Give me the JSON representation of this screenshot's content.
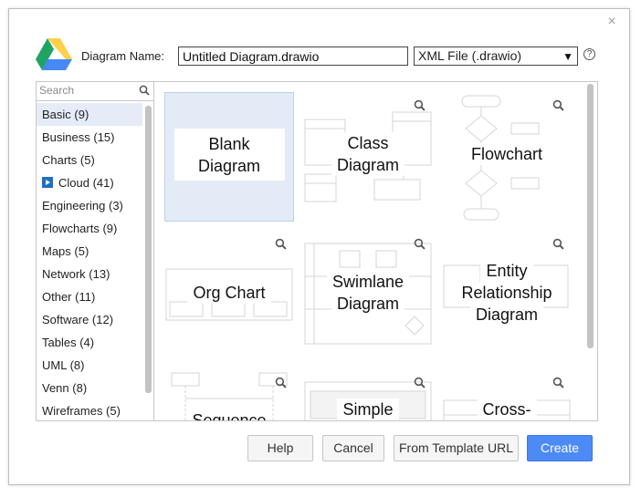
{
  "header": {
    "name_label": "Diagram Name:",
    "name_value": "Untitled Diagram.drawio",
    "format_value": "XML File (.drawio)",
    "help_glyph": "?",
    "close_glyph": "×"
  },
  "sidebar": {
    "search_placeholder": "Search",
    "categories": [
      {
        "label": "Basic (9)"
      },
      {
        "label": "Business (15)"
      },
      {
        "label": "Charts (5)"
      },
      {
        "label": "Cloud (41)"
      },
      {
        "label": "Engineering (3)"
      },
      {
        "label": "Flowcharts (9)"
      },
      {
        "label": "Maps (5)"
      },
      {
        "label": "Network (13)"
      },
      {
        "label": "Other (11)"
      },
      {
        "label": "Software (12)"
      },
      {
        "label": "Tables (4)"
      },
      {
        "label": "UML (8)"
      },
      {
        "label": "Venn (8)"
      },
      {
        "label": "Wireframes (5)"
      }
    ]
  },
  "templates": [
    {
      "l1": "Blank",
      "l2": "Diagram"
    },
    {
      "l1": "Class",
      "l2": "Diagram"
    },
    {
      "l1": "Flowchart"
    },
    {
      "l1": "Org Chart"
    },
    {
      "l1": "Swimlane",
      "l2": "Diagram"
    },
    {
      "l1": "Entity",
      "l2": "Relationship",
      "l3": "Diagram"
    },
    {
      "l1": "Sequence"
    },
    {
      "l1": "Simple"
    },
    {
      "l1": "Cross-"
    }
  ],
  "buttons": {
    "help": "Help",
    "cancel": "Cancel",
    "from_template_url": "From Template URL",
    "create": "Create"
  },
  "colors": {
    "primary": "#4c8bf5",
    "selection": "#e3ebf6",
    "drive_green": "#1fa463",
    "drive_yellow": "#ffd04b",
    "drive_blue": "#4688f4"
  }
}
